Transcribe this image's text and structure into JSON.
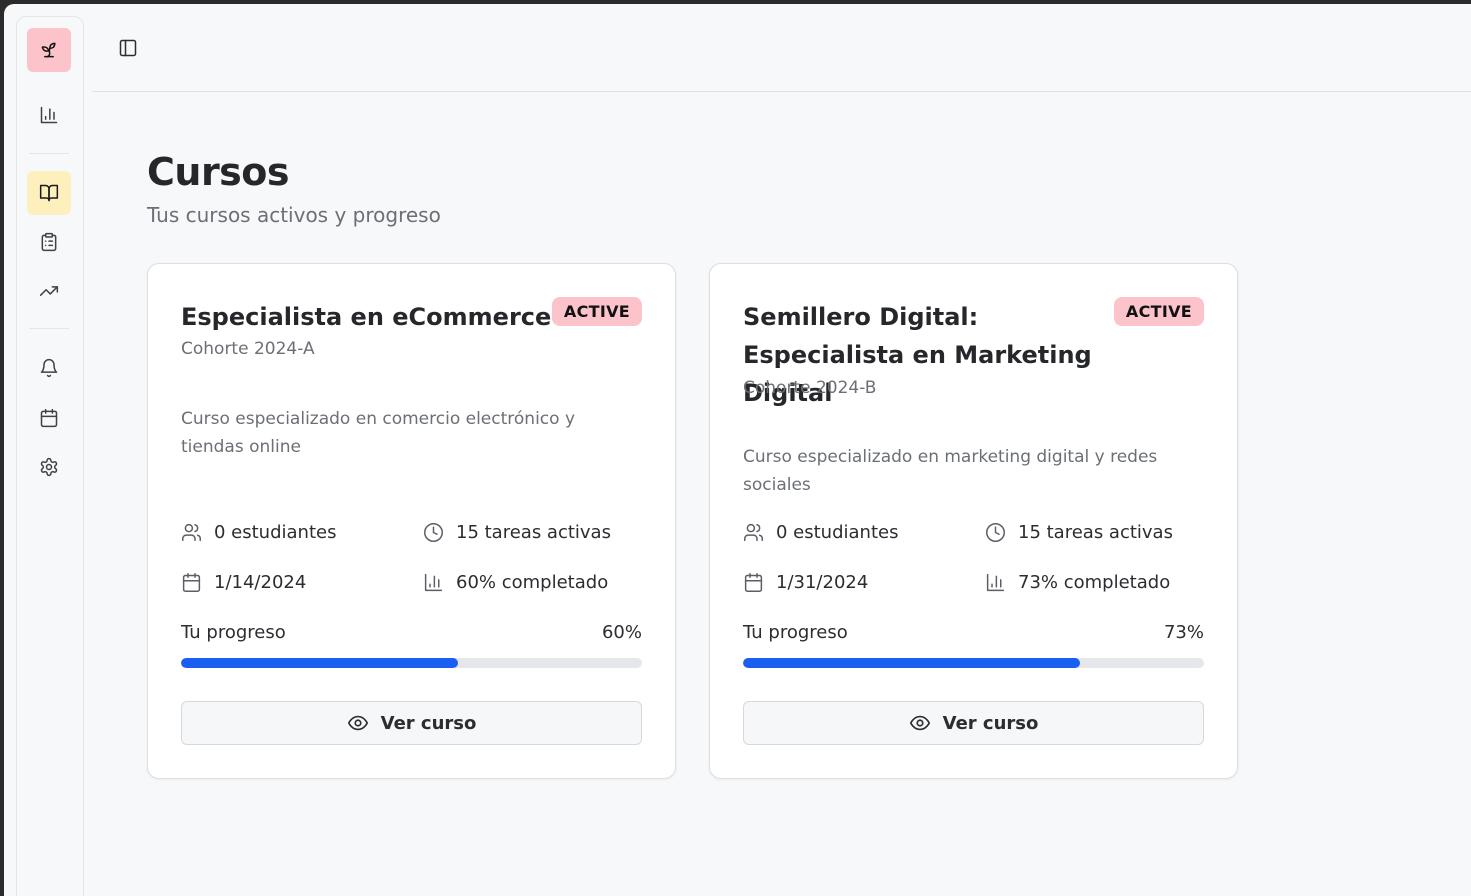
{
  "colors": {
    "accent_logo": "#fcc3cb",
    "active_nav": "#fdf0bc",
    "progress_fill": "#1a5ef2",
    "progress_track": "#e6e7ea",
    "badge": "#fcc3cb"
  },
  "sidebar": {
    "items": [
      {
        "name": "sprout-logo-icon",
        "active": false
      },
      {
        "name": "bar-chart-icon",
        "active": false
      },
      {
        "name": "book-open-icon",
        "active": true
      },
      {
        "name": "clipboard-list-icon",
        "active": false
      },
      {
        "name": "trending-up-icon",
        "active": false
      },
      {
        "name": "bell-icon",
        "active": false
      },
      {
        "name": "calendar-icon",
        "active": false
      },
      {
        "name": "settings-gear-icon",
        "active": false
      }
    ]
  },
  "topbar": {
    "toggle_icon": "sidebar-toggle-icon"
  },
  "page": {
    "title": "Cursos",
    "subtitle": "Tus cursos activos y progreso"
  },
  "courses": [
    {
      "title": "Especialista en eCommerce",
      "badge": "ACTIVE",
      "cohort": "Cohorte 2024-A",
      "description": "Curso especializado en comercio electrónico y tiendas online",
      "students": "0 estudiantes",
      "tasks": "15 tareas activas",
      "date": "1/14/2024",
      "completed": "60% completado",
      "progress_label": "Tu progreso",
      "progress_text": "60%",
      "progress": 0.6,
      "button": "Ver curso"
    },
    {
      "title": "Semillero Digital: Especialista en Marketing Digital",
      "badge": "ACTIVE",
      "cohort": "Cohorte 2024-B",
      "description": "Curso especializado en marketing digital y redes sociales",
      "students": "0 estudiantes",
      "tasks": "15 tareas activas",
      "date": "1/31/2024",
      "completed": "73% completado",
      "progress_label": "Tu progreso",
      "progress_text": "73%",
      "progress": 0.73,
      "button": "Ver curso"
    }
  ]
}
